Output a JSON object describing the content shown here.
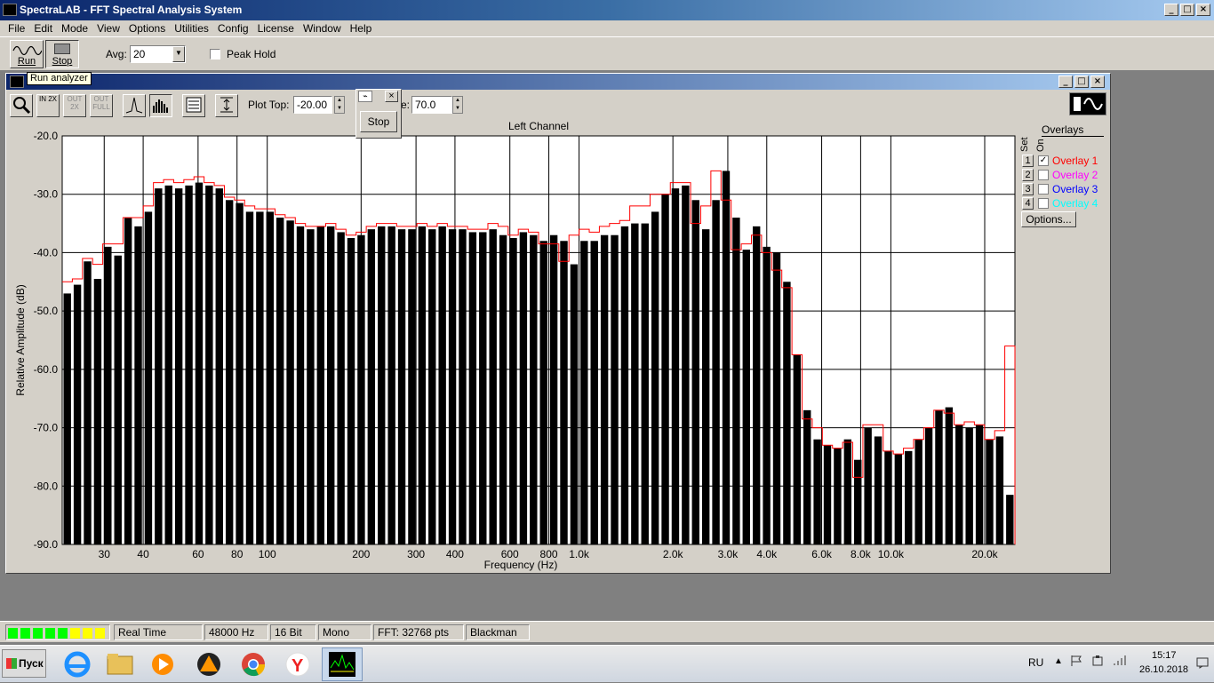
{
  "app": {
    "title": "SpectraLAB - FFT Spectral Analysis System",
    "menu": [
      "File",
      "Edit",
      "Mode",
      "View",
      "Options",
      "Utilities",
      "Config",
      "License",
      "Window",
      "Help"
    ]
  },
  "toolbar": {
    "run_label": "Run",
    "stop_label": "Stop",
    "avg_label": "Avg:",
    "avg_value": "20",
    "peak_hold_label": "Peak Hold"
  },
  "tooltip": "Run analyzer",
  "popup": {
    "stop_label": "Stop"
  },
  "spectrum_window": {
    "plot_top_label": "Plot Top:",
    "plot_top_value": "-20.00",
    "plot_range_label_visible": "e:",
    "plot_range_value": "70.0",
    "zoom_in_label": "IN 2X",
    "zoom_out_label": "OUT 2X",
    "zoom_full_label": "OUT FULL"
  },
  "overlays": {
    "title": "Overlays",
    "set_label": "Set",
    "on_label": "On",
    "items": [
      {
        "num": "1",
        "label": "Overlay 1",
        "color": "#ff0000",
        "checked": true
      },
      {
        "num": "2",
        "label": "Overlay 2",
        "color": "#ff00ff",
        "checked": false
      },
      {
        "num": "3",
        "label": "Overlay 3",
        "color": "#0000ff",
        "checked": false
      },
      {
        "num": "4",
        "label": "Overlay 4",
        "color": "#00ffff",
        "checked": false
      }
    ],
    "options_label": "Options..."
  },
  "status": {
    "mode": "Real Time",
    "rate": "48000 Hz",
    "bits": "16 Bit",
    "channels": "Mono",
    "fft": "FFT: 32768 pts",
    "window": "Blackman",
    "level_leds": [
      "#00ff00",
      "#00ff00",
      "#00ff00",
      "#00ff00",
      "#00ff00",
      "#ffff00",
      "#ffff00",
      "#ffff00"
    ]
  },
  "taskbar": {
    "start_label": "Пуск",
    "lang": "RU",
    "time": "15:17",
    "date": "26.10.2018"
  },
  "chart_data": {
    "type": "bar",
    "title": "Left Channel",
    "xlabel": "Frequency (Hz)",
    "ylabel": "Relative Amplitude (dB)",
    "x_scale": "log",
    "xlim": [
      22,
      25000
    ],
    "ylim": [
      -90,
      -20
    ],
    "yticks": [
      "-20.0",
      "-30.0",
      "-40.0",
      "-50.0",
      "-60.0",
      "-70.0",
      "-80.0",
      "-90.0"
    ],
    "xticks": [
      {
        "v": 30,
        "l": "30"
      },
      {
        "v": 40,
        "l": "40"
      },
      {
        "v": 60,
        "l": "60"
      },
      {
        "v": 80,
        "l": "80"
      },
      {
        "v": 100,
        "l": "100"
      },
      {
        "v": 200,
        "l": "200"
      },
      {
        "v": 300,
        "l": "300"
      },
      {
        "v": 400,
        "l": "400"
      },
      {
        "v": 600,
        "l": "600"
      },
      {
        "v": 800,
        "l": "800"
      },
      {
        "v": 1000,
        "l": "1.0k"
      },
      {
        "v": 2000,
        "l": "2.0k"
      },
      {
        "v": 3000,
        "l": "3.0k"
      },
      {
        "v": 4000,
        "l": "4.0k"
      },
      {
        "v": 6000,
        "l": "6.0k"
      },
      {
        "v": 8000,
        "l": "8.0k"
      },
      {
        "v": 10000,
        "l": "10.0k"
      },
      {
        "v": 20000,
        "l": "20.0k"
      }
    ],
    "grid": true,
    "series": [
      {
        "name": "Left Channel",
        "color": "#000000",
        "values": [
          -47,
          -45.5,
          -41.5,
          -44.5,
          -39,
          -40.5,
          -34,
          -35.5,
          -33,
          -29,
          -28.5,
          -29,
          -28.5,
          -28,
          -28.5,
          -29,
          -31,
          -31.5,
          -33,
          -33,
          -33,
          -34,
          -34.5,
          -35.5,
          -36,
          -35.5,
          -35.5,
          -36.5,
          -37.5,
          -37,
          -36,
          -35.5,
          -35.5,
          -36,
          -36,
          -35.5,
          -36,
          -35.5,
          -36,
          -36,
          -36.5,
          -36.5,
          -36,
          -37,
          -37.5,
          -36.5,
          -37,
          -38,
          -37,
          -38,
          -42,
          -38,
          -38,
          -37,
          -37,
          -35.5,
          -35,
          -35,
          -33,
          -30,
          -29,
          -28.5,
          -31,
          -36,
          -31,
          -26,
          -34,
          -39.5,
          -35.5,
          -39,
          -40,
          -45,
          -57.5,
          -67,
          -72,
          -73,
          -73.5,
          -72,
          -75.5,
          -70,
          -71.5,
          -74,
          -74.5,
          -74,
          -72,
          -70,
          -67,
          -66.5,
          -69.5,
          -70,
          -69.5,
          -72,
          -71.5,
          -81.5
        ],
        "note": "dB"
      },
      {
        "name": "Overlay 1",
        "color": "#ff0000",
        "values": [
          -45,
          -44.5,
          -41,
          -42,
          -38.5,
          -38.5,
          -34,
          -34,
          -32,
          -28,
          -27.5,
          -28,
          -27.5,
          -27,
          -28,
          -28.5,
          -30.5,
          -31,
          -32,
          -32.5,
          -32.5,
          -33.5,
          -34,
          -35,
          -35.5,
          -35.5,
          -35,
          -36,
          -37,
          -36.5,
          -35.5,
          -35,
          -35,
          -35.5,
          -35.5,
          -35,
          -35.5,
          -35,
          -35.5,
          -35.5,
          -36,
          -36,
          -35,
          -35.5,
          -37,
          -36,
          -36.5,
          -38.5,
          -38.5,
          -41.5,
          -37,
          -36,
          -36.5,
          -35.5,
          -35,
          -34.5,
          -32,
          -32,
          -30,
          -30,
          -28,
          -28,
          -35,
          -32,
          -26,
          -31,
          -39.5,
          -38.5,
          -37,
          -40,
          -43,
          -46,
          -57.5,
          -68.5,
          -70,
          -73,
          -73.5,
          -72.5,
          -78.5,
          -69.5,
          -69.5,
          -74,
          -74.5,
          -73.5,
          -72,
          -70,
          -67,
          -67.5,
          -69.5,
          -69,
          -69.5,
          -72,
          -70.5,
          -56
        ]
      }
    ]
  }
}
